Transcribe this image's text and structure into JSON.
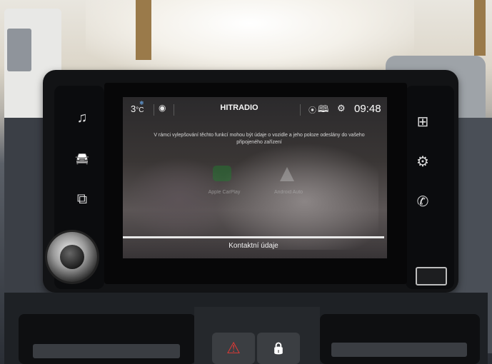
{
  "status_bar": {
    "temperature": "3",
    "temperature_unit": "°C",
    "station": "HITRADIO",
    "time": "09:48"
  },
  "info_text": "V rámci vylepšování těchto funkcí mohou být údaje o vozidle a jeho poloze odeslány do vašeho připojeného zařízení",
  "apps": [
    {
      "label": "Apple CarPlay",
      "icon": "carplay-icon",
      "color": "#1f7f2e"
    },
    {
      "label": "Android Auto",
      "icon": "android-auto-icon",
      "color": "#bcbcbc"
    }
  ],
  "bottom_action": "Kontaktní údaje",
  "left_buttons": [
    {
      "name": "music",
      "icon": "music-note-icon",
      "glyph": "♫"
    },
    {
      "name": "car",
      "icon": "car-icon",
      "glyph": "🚘"
    },
    {
      "name": "navigation",
      "icon": "navigation-icon",
      "glyph": "⧉"
    }
  ],
  "right_buttons": [
    {
      "name": "apps",
      "icon": "apps-grid-icon",
      "glyph": "⊞"
    },
    {
      "name": "settings",
      "icon": "gear-icon",
      "glyph": "⚙"
    },
    {
      "name": "phone",
      "icon": "phone-icon",
      "glyph": "✆"
    }
  ],
  "icons": {
    "pin": "◉",
    "gps": "⦿",
    "book": "🕮",
    "gear": "⚙",
    "hazard": "⚠",
    "lock": "🔒"
  },
  "colors": {
    "accent_temperature": "#6fb6ff",
    "hazard": "#e53935"
  }
}
